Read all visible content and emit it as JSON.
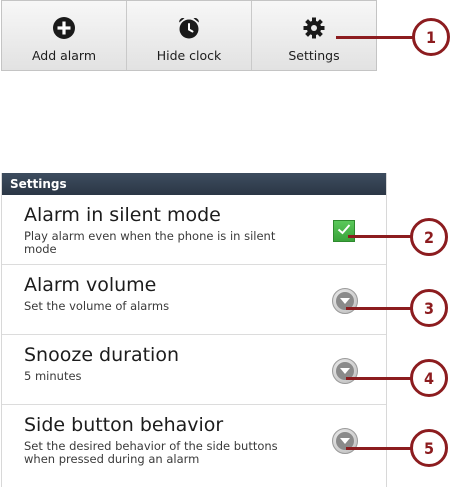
{
  "menu": {
    "items": [
      {
        "label": "Add alarm",
        "icon": "plus-circle-icon"
      },
      {
        "label": "Hide clock",
        "icon": "alarm-clock-icon"
      },
      {
        "label": "Settings",
        "icon": "gear-icon"
      }
    ]
  },
  "settings": {
    "header": "Settings",
    "rows": [
      {
        "title": "Alarm in silent mode",
        "subtitle": "Play alarm even when the phone is in silent mode",
        "control": "checkbox",
        "checked": true
      },
      {
        "title": "Alarm volume",
        "subtitle": "Set the volume of alarms",
        "control": "dropdown"
      },
      {
        "title": "Snooze duration",
        "subtitle": "5 minutes",
        "control": "dropdown"
      },
      {
        "title": "Side button behavior",
        "subtitle": "Set the desired behavior of the side buttons when pressed during an alarm",
        "control": "dropdown"
      }
    ]
  },
  "callouts": [
    "1",
    "2",
    "3",
    "4",
    "5"
  ],
  "colors": {
    "callout": "#8c1c1f",
    "checkbox": "#44b044",
    "header": "#344252"
  }
}
